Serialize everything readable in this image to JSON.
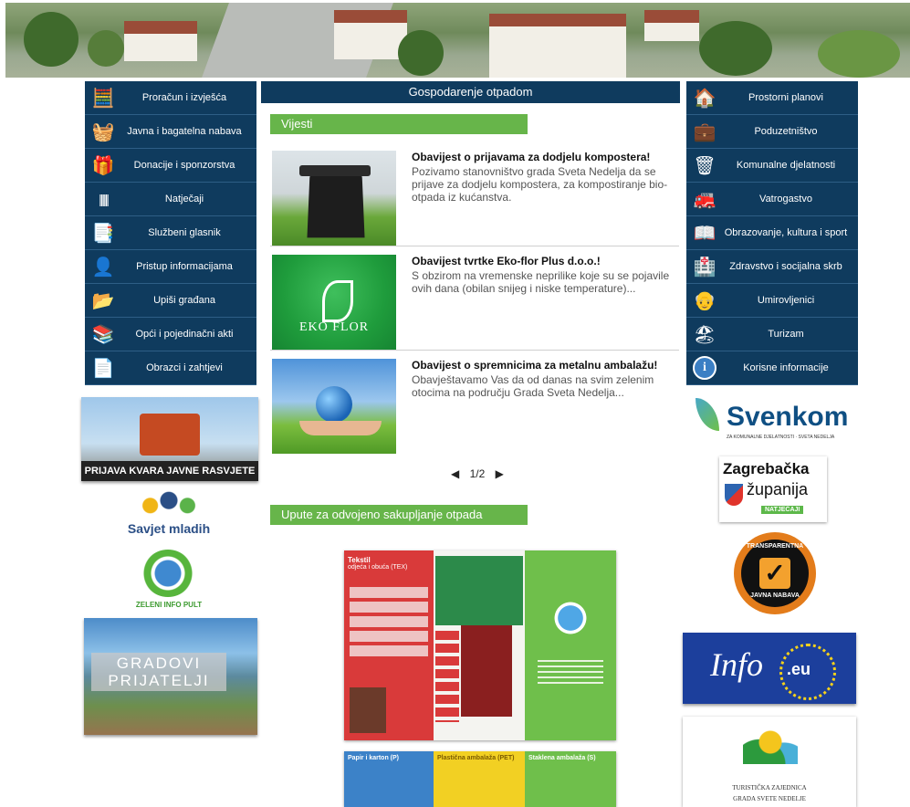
{
  "left_menu": [
    {
      "label": "Proračun i izvješća",
      "icon": "calculator-icon"
    },
    {
      "label": "Javna i bagatelna nabava",
      "icon": "shopping-basket-icon"
    },
    {
      "label": "Donacije i sponzorstva",
      "icon": "gift-icon"
    },
    {
      "label": "Natječaji",
      "icon": "barcode-icon"
    },
    {
      "label": "Službeni glasnik",
      "icon": "documents-icon"
    },
    {
      "label": "Pristup informacijama",
      "icon": "person-info-icon"
    },
    {
      "label": "Upiši građana",
      "icon": "folder-search-icon"
    },
    {
      "label": "Opći i pojedinačni akti",
      "icon": "binders-icon"
    },
    {
      "label": "Obrazci i zahtjevi",
      "icon": "forms-icon"
    }
  ],
  "right_menu": [
    {
      "label": "Prostorni planovi",
      "icon": "house-plan-icon"
    },
    {
      "label": "Poduzetništvo",
      "icon": "briefcase-icon"
    },
    {
      "label": "Komunalne djelatnosti",
      "icon": "trash-bin-icon"
    },
    {
      "label": "Vatrogastvo",
      "icon": "fire-truck-icon"
    },
    {
      "label": "Obrazovanje, kultura i sport",
      "icon": "book-icon"
    },
    {
      "label": "Zdravstvo i socijalna skrb",
      "icon": "hospital-icon"
    },
    {
      "label": "Umirovljenici",
      "icon": "elderly-person-icon"
    },
    {
      "label": "Turizam",
      "icon": "beach-icon"
    },
    {
      "label": "Korisne informacije",
      "icon": "info-icon"
    }
  ],
  "center": {
    "heading": "Gospodarenje otpadom",
    "news_tab": "Vijesti",
    "news": [
      {
        "title": "Obavijest o prijavama za dodjelu kompostera!",
        "text": "Pozivamo stanovništvo grada Sveta Nedelja da se prijave za dodjelu kompostera, za kompostiranje bio-otpada iz kućanstva."
      },
      {
        "title": "Obavijest tvrtke Eko-flor Plus d.o.o.!",
        "text": "S obzirom na vremenske neprilike koje su se pojavile ovih dana (obilan snijeg i niske temperature)..."
      },
      {
        "title": "Obavijest o spremnicima za metalnu ambalažu!",
        "text": "Obavještavamo Vas da od danas na svim zelenim otocima na području Grada Sveta Nedelja..."
      }
    ],
    "pager": "1/2",
    "guide_tab": "Upute za odvojeno sakupljanje otpada",
    "ekoflor_logo": "EKO FLOR",
    "leaflet": {
      "col1_title": "Tekstil",
      "col1_sub": "odjeća i obuća (TEX)",
      "col2_title": "Papir i karton (P)",
      "col3_title": "Plastična ambalaža (PET)",
      "col4_title": "Staklena ambalaža (S)"
    }
  },
  "left_banners": {
    "lighting": "PRIJAVA KVARA JAVNE RASVJETE",
    "youth": "Savjet mladih",
    "green_pult": "ZELENI INFO PULT",
    "cities": "GRADOVI PRIJATELJI"
  },
  "right_banners": {
    "svenkom": "Svenkom",
    "svenkom_sub": "ZA KOMUNALNE DJELATNOSTI · SVETA NEDELJA",
    "zagreb1": "Zagrebačka",
    "zagreb2": "županija",
    "zagreb3": "NATJEČAJI",
    "transparent_top": "TRANSPARENTNA",
    "transparent_bottom": "JAVNA NABAVA",
    "info": "Info",
    "eu": ".eu",
    "tourism1": "TURISTIČKA ZAJEDNICA",
    "tourism2": "GRADA SVETE NEDELJE"
  },
  "colors": {
    "menu_bg": "#0f3b5e",
    "green": "#67b54a"
  }
}
